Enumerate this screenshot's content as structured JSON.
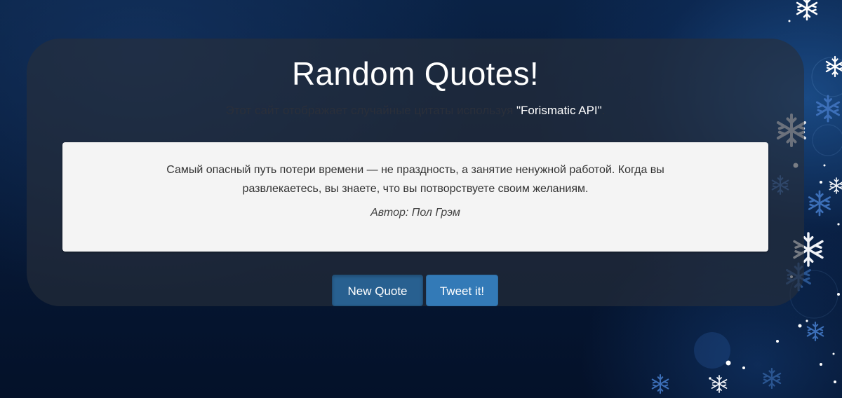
{
  "page": {
    "title": "Random Quotes!",
    "subtitle_prefix": "Этот сайт отображает случайные цитаты используя ",
    "api_link": "\"Forismatic API\"",
    "subtitle_suffix": "."
  },
  "quote": {
    "text": "Самый опасный путь потери времени — не праздность, а занятие ненужной работой. Когда вы развлекаетесь, вы знаете, что вы потворствуете своим желаниям.",
    "author": "Автор: Пол Грэм"
  },
  "buttons": {
    "new_quote": "New Quote",
    "tweet": "Tweet it!"
  },
  "colors": {
    "background": "#071a38",
    "panel": "#282e3a",
    "quote_box": "#f4f4f4",
    "button_primary": "#337ab7",
    "button_active": "#286090"
  },
  "icons": {
    "background_decoration": "snowflake-icon"
  }
}
